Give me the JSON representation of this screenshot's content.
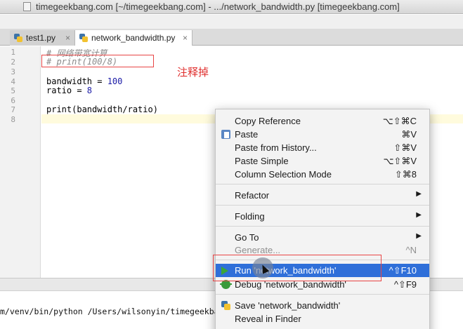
{
  "window": {
    "title": "timegeekbang.com [~/timegeekbang.com] - .../network_bandwidth.py [timegeekbang.com]"
  },
  "tabs": [
    {
      "label": "test1.py",
      "close": "×",
      "active": false
    },
    {
      "label": "network_bandwidth.py",
      "close": "×",
      "active": true
    }
  ],
  "editor": {
    "line_numbers": [
      "1",
      "2",
      "3",
      "4",
      "5",
      "6",
      "7",
      "8"
    ],
    "lines": {
      "l1": "# 网络带宽计算",
      "l2": "# print(100/8)",
      "l4_var": "bandwidth = ",
      "l4_num": "100",
      "l5_var": "ratio = ",
      "l5_num": "8",
      "l7": "print(bandwidth/ratio)"
    },
    "current_line": "8"
  },
  "annotation": {
    "text": "注释掉"
  },
  "context_menu": {
    "items": {
      "copy_reference": {
        "label": "Copy Reference",
        "shortcut": "⌥⇧⌘C"
      },
      "paste": {
        "label": "Paste",
        "shortcut": "⌘V"
      },
      "paste_history": {
        "label": "Paste from History...",
        "shortcut": "⇧⌘V"
      },
      "paste_simple": {
        "label": "Paste Simple",
        "shortcut": "⌥⇧⌘V"
      },
      "column_selection": {
        "label": "Column Selection Mode",
        "shortcut": "⇧⌘8"
      },
      "refactor": {
        "label": "Refactor",
        "arrow": "▶"
      },
      "folding": {
        "label": "Folding",
        "arrow": "▶"
      },
      "go_to": {
        "label": "Go To",
        "arrow": "▶"
      },
      "generate": {
        "label": "Generate...",
        "shortcut": "^N"
      },
      "run": {
        "label": "Run 'network_bandwidth'",
        "shortcut": "^⇧F10"
      },
      "debug": {
        "label": "Debug 'network_bandwidth'",
        "shortcut": "^⇧F9"
      },
      "save": {
        "label": "Save 'network_bandwidth'"
      },
      "reveal": {
        "label": "Reveal in Finder"
      }
    }
  },
  "console": {
    "command": "m/venv/bin/python /Users/wilsonyin/timegeekbang"
  },
  "colors": {
    "menu_highlight": "#2f6fd9",
    "annotation_red": "#e0302f"
  }
}
